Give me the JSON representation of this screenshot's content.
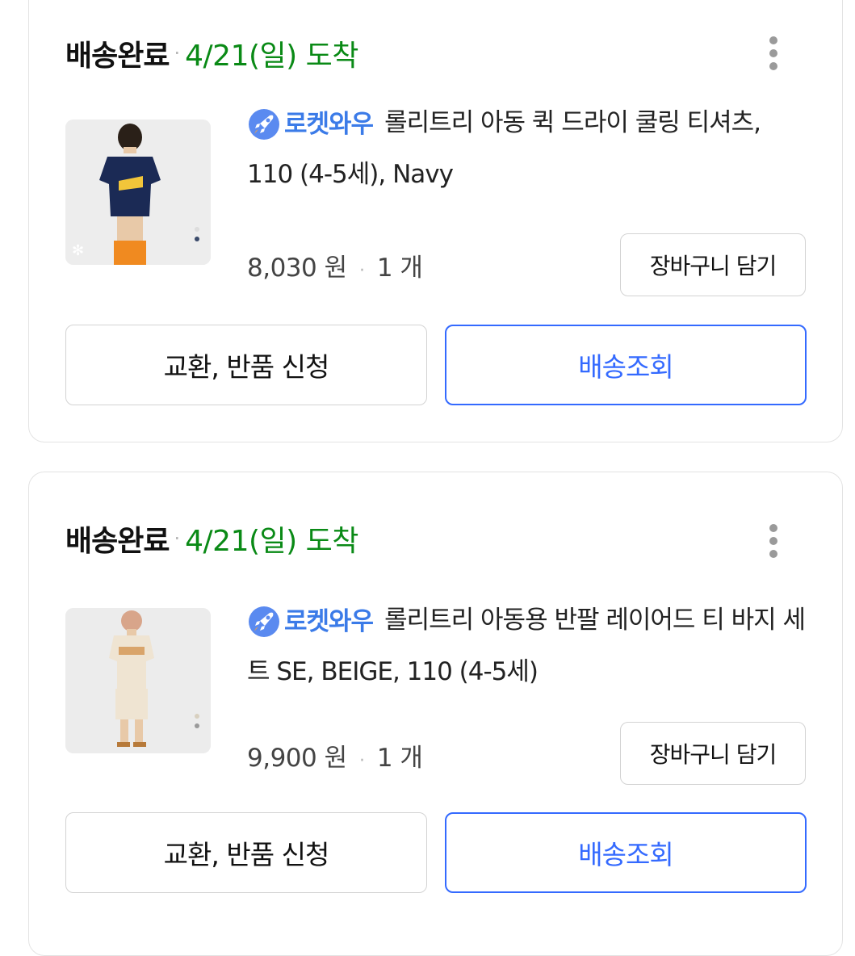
{
  "orders": [
    {
      "status": "배송완료",
      "separator": "·",
      "arrival": "4/21(일) 도착",
      "badge_label": "로켓와우",
      "product_title": "롤리트리 아동 퀵 드라이 쿨링 티셔츠, 110 (4-5세), Navy",
      "price": "8,030 원",
      "quantity": "1 개",
      "cart_button": "장바구니 담기",
      "exchange_button": "교환, 반품 신청",
      "tracking_button": "배송조회"
    },
    {
      "status": "배송완료",
      "separator": "·",
      "arrival": "4/21(일) 도착",
      "badge_label": "로켓와우",
      "product_title": "롤리트리 아동용 반팔 레이어드 티 바지 세트 SE, BEIGE, 110 (4-5세)",
      "price": "9,900 원",
      "quantity": "1 개",
      "cart_button": "장바구니 담기",
      "exchange_button": "교환, 반품 신청",
      "tracking_button": "배송조회"
    }
  ],
  "colors": {
    "arrival_green": "#0a8a16",
    "rocket_blue": "#3b7be8",
    "track_blue": "#346aff"
  },
  "icons": [
    "rocket-wow-icon",
    "more-options-icon"
  ]
}
